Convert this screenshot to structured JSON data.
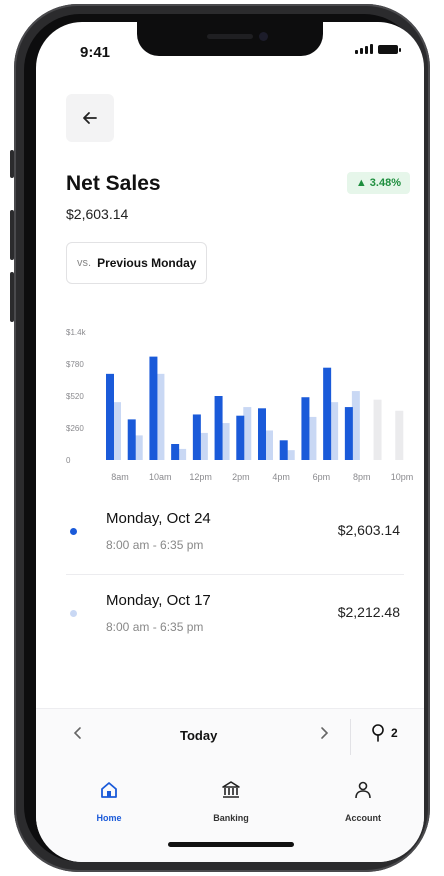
{
  "status_bar": {
    "time": "9:41"
  },
  "header": {
    "back_icon": "arrow-left-icon"
  },
  "summary": {
    "title": "Net Sales",
    "total": "$2,603.14",
    "change": "▲ 3.48%",
    "change_color": "#1e8e3e"
  },
  "comparison": {
    "prefix": "vs.",
    "label": "Previous Monday"
  },
  "chart_data": {
    "type": "bar",
    "y_tick_labels": [
      "$1.4k",
      "$780",
      "$520",
      "$260",
      "0"
    ],
    "x_tick_labels": [
      "8am",
      "10am",
      "12pm",
      "2pm",
      "4pm",
      "6pm",
      "8pm",
      "10pm"
    ],
    "ylim": [
      0,
      1040
    ],
    "series": [
      {
        "name": "Monday, Oct 24",
        "color": "#1a5ad9",
        "values": [
          700,
          330,
          840,
          130,
          370,
          520,
          360,
          420,
          160,
          510,
          750,
          430,
          null,
          null
        ]
      },
      {
        "name": "Monday, Oct 17",
        "color": "#c9d8f4",
        "values": [
          470,
          200,
          700,
          90,
          220,
          300,
          430,
          240,
          80,
          350,
          470,
          560,
          490,
          400
        ]
      }
    ],
    "future_color": "#ebebed"
  },
  "periods": [
    {
      "day": "Monday, Oct 24",
      "hours": "8:00 am - 6:35 pm",
      "amount": "$2,603.14",
      "color": "#1a5ad9"
    },
    {
      "day": "Monday, Oct 17",
      "hours": "8:00 am - 6:35 pm",
      "amount": "$2,212.48",
      "color": "#c9d8f4"
    }
  ],
  "date_nav": {
    "prev_icon": "chevron-left-icon",
    "label": "Today",
    "next_icon": "chevron-right-icon",
    "location_icon": "location-pin-icon",
    "location_count": "2"
  },
  "tabs": [
    {
      "label": "Home",
      "icon": "home-icon",
      "active": true
    },
    {
      "label": "Banking",
      "icon": "bank-icon",
      "active": false
    },
    {
      "label": "Account",
      "icon": "person-icon",
      "active": false
    }
  ],
  "colors": {
    "accent": "#1a5ad9",
    "positive": "#1e8e3e"
  }
}
